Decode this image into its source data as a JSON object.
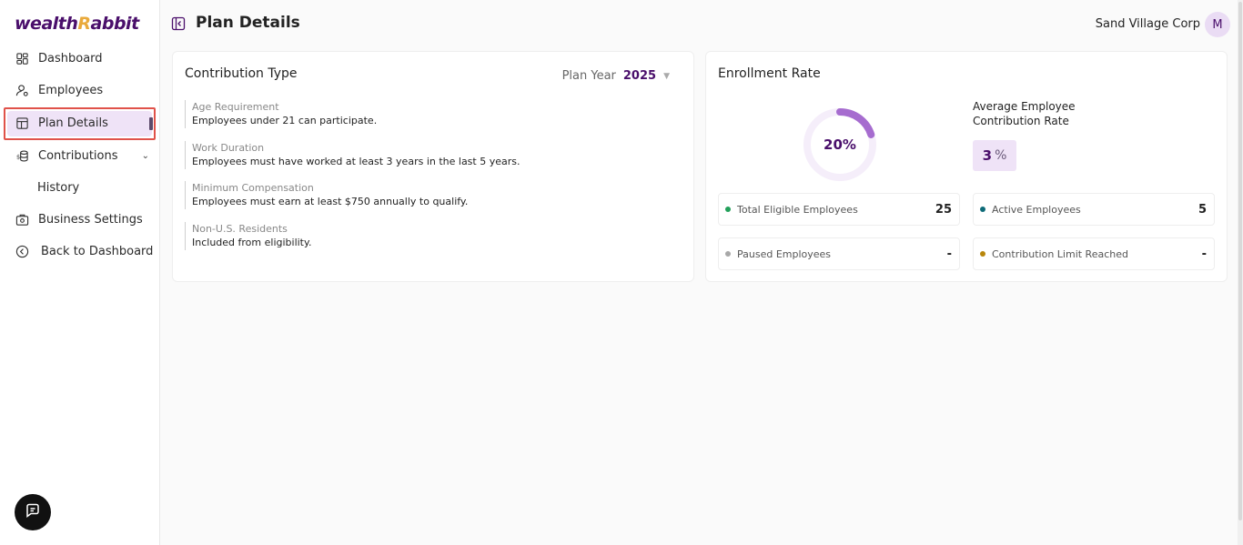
{
  "brand": {
    "logo_pre": "wealth",
    "logo_r": "R",
    "logo_post": "abbit"
  },
  "sidebar": {
    "items": [
      {
        "label": "Dashboard"
      },
      {
        "label": "Employees"
      },
      {
        "label": "Plan Details"
      },
      {
        "label": "Contributions"
      },
      {
        "label": "History"
      },
      {
        "label": "Business Settings"
      },
      {
        "label": "Back to Dashboard"
      }
    ]
  },
  "header": {
    "title": "Plan Details",
    "org": "Sand Village Corp",
    "avatar": "M"
  },
  "contribution": {
    "title": "Contribution Type",
    "plan_year_label": "Plan Year",
    "plan_year_value": "2025",
    "requirements": [
      {
        "label": "Age Requirement",
        "value": "Employees under 21 can participate."
      },
      {
        "label": "Work Duration",
        "value": "Employees must have worked at least 3 years in the last 5 years."
      },
      {
        "label": "Minimum Compensation",
        "value": "Employees must earn at least $750 annually to qualify."
      },
      {
        "label": "Non-U.S. Residents",
        "value": "Included from eligibility."
      }
    ]
  },
  "enrollment": {
    "title": "Enrollment Rate",
    "rate_label": "20%",
    "rate_fraction": 0.2,
    "avg_label": "Average Employee Contribution Rate",
    "avg_value": "3",
    "avg_unit": "%",
    "stats": [
      {
        "label": "Total Eligible Employees",
        "value": "25",
        "color": "#22a05a"
      },
      {
        "label": "Active Employees",
        "value": "5",
        "color": "#0e6b78"
      },
      {
        "label": "Paused Employees",
        "value": "-",
        "color": "#a8a8a8"
      },
      {
        "label": "Contribution Limit Reached",
        "value": "-",
        "color": "#b8860b"
      }
    ]
  },
  "colors": {
    "brand": "#4a0f6b",
    "accent": "#e9a93a",
    "active_bg": "#efe3f7",
    "donut": "#a66ccf",
    "donut_track": "#f5eefa"
  }
}
